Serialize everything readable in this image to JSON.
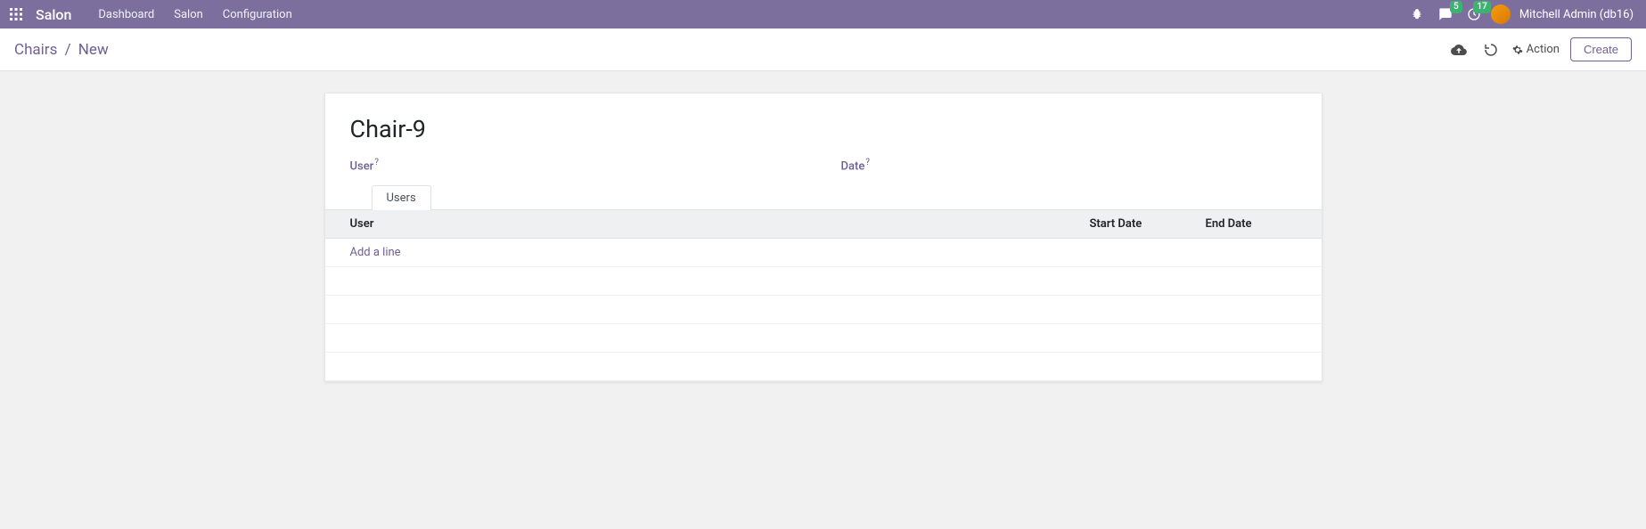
{
  "navbar": {
    "app_title": "Salon",
    "menu": [
      "Dashboard",
      "Salon",
      "Configuration"
    ],
    "messages_count": "5",
    "activities_count": "17",
    "user_display": "Mitchell Admin (db16)"
  },
  "controlbar": {
    "breadcrumb_root": "Chairs",
    "breadcrumb_current": "New",
    "action_label": "Action",
    "create_label": "Create"
  },
  "form": {
    "title": "Chair-9",
    "user_label": "User",
    "date_label": "Date",
    "help_symbol": "?"
  },
  "tabs": {
    "users": "Users"
  },
  "table": {
    "headers": {
      "user": "User",
      "start_date": "Start Date",
      "end_date": "End Date"
    },
    "add_line": "Add a line"
  }
}
